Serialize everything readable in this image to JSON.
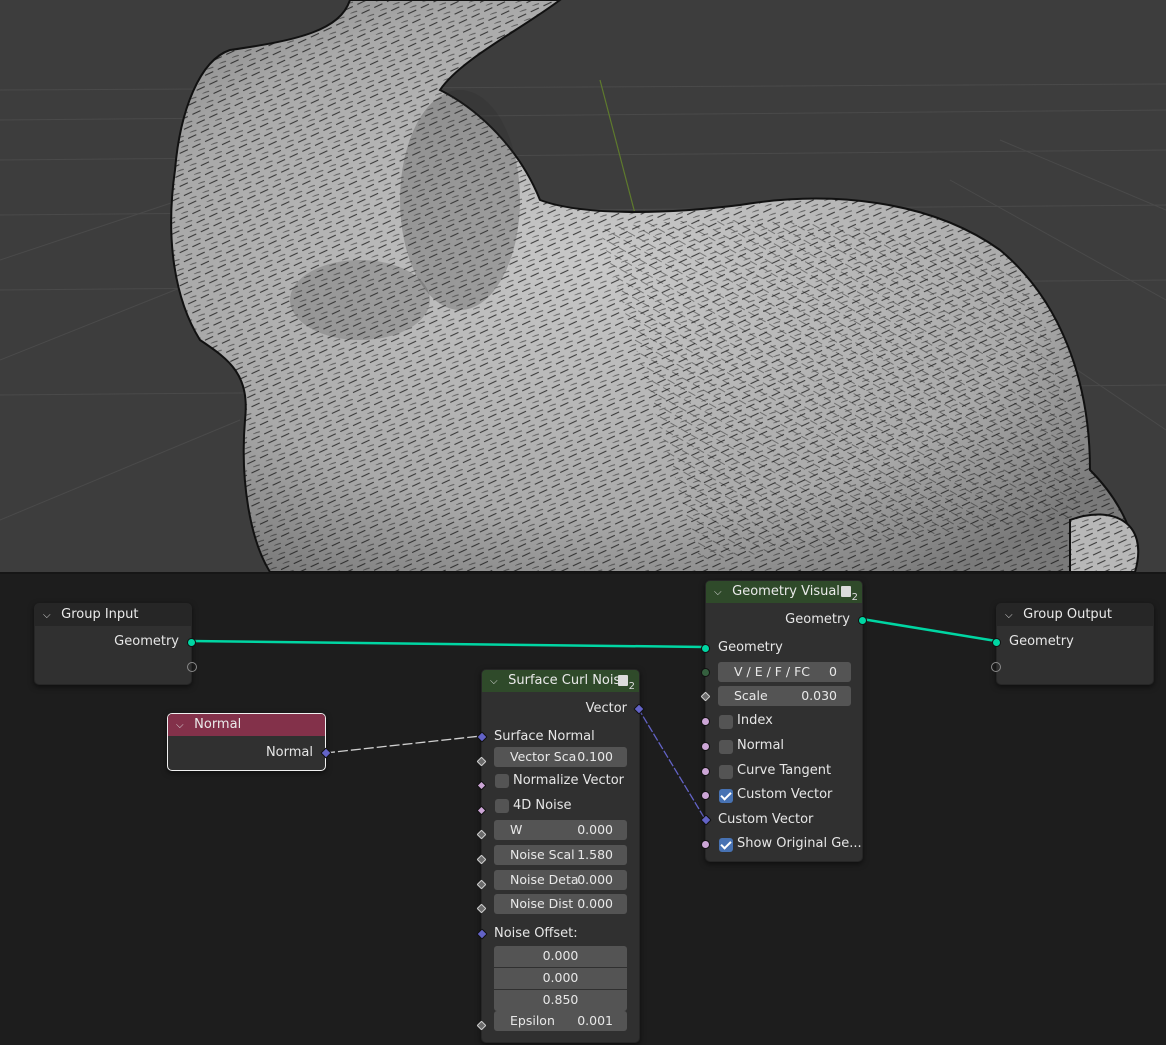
{
  "nodes": {
    "group_input": {
      "title": "Group Input",
      "outputs": [
        "Geometry"
      ]
    },
    "normal": {
      "title": "Normal",
      "outputs": [
        "Normal"
      ]
    },
    "curl_noise": {
      "title": "Surface Curl Noise",
      "badge_count": "2",
      "output": "Vector",
      "surface_normal": "Surface Normal",
      "vector_scale": {
        "label": "Vector Sca",
        "value": "0.100"
      },
      "normalize_vector": "Normalize Vector",
      "noise_4d": "4D Noise",
      "w": {
        "label": "W",
        "value": "0.000"
      },
      "noise_scale": {
        "label": "Noise Scal",
        "value": "1.580"
      },
      "noise_detail": {
        "label": "Noise Deta",
        "value": "0.000"
      },
      "noise_distortion": {
        "label": "Noise Dist",
        "value": "0.000"
      },
      "noise_offset_label": "Noise Offset:",
      "noise_offset": [
        "0.000",
        "0.000",
        "0.850"
      ],
      "epsilon": {
        "label": "Epsilon",
        "value": "0.001"
      }
    },
    "geo_visual": {
      "title": "Geometry Visual..",
      "badge_count": "2",
      "output": "Geometry",
      "input_geometry": "Geometry",
      "mode": {
        "label": "V / E / F / FC",
        "value": "0"
      },
      "scale": {
        "label": "Scale",
        "value": "0.030"
      },
      "index": "Index",
      "normal": "Normal",
      "curve_tangent": "Curve Tangent",
      "custom_vector_toggle": "Custom Vector",
      "custom_vector_input": "Custom Vector",
      "show_original": "Show Original Ge..."
    },
    "group_output": {
      "title": "Group Output",
      "inputs": [
        "Geometry"
      ]
    }
  },
  "checkboxes": {
    "normalize_vector": false,
    "noise_4d": false,
    "index": false,
    "normal": false,
    "curve_tangent": false,
    "custom_vector": true,
    "show_original": true
  },
  "colors": {
    "geometry_socket": "#00d6a3",
    "vector_socket": "#6363c7",
    "header_green": "#2f4a2a",
    "header_pink": "#83314a",
    "checkbox_on": "#4772b3"
  }
}
